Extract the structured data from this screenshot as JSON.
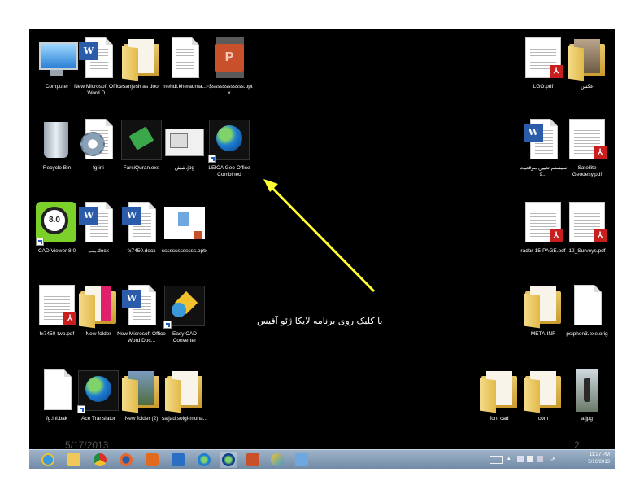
{
  "desktop": {
    "icons": [
      {
        "label": "Computer",
        "icon": "computer-icon"
      },
      {
        "label": "New Microsoft Office Word D...",
        "icon": "word-doc-icon"
      },
      {
        "label": "sanjesh as door",
        "icon": "folder-icon"
      },
      {
        "label": "mehdi.kheradma...",
        "icon": "text-file-icon"
      },
      {
        "label": "~$ssssssssssss.pptx",
        "icon": "pptx-icon"
      },
      {
        "label": "Recycle Bin",
        "icon": "recycle-bin-icon"
      },
      {
        "label": "fg.ini",
        "icon": "ini-settings-icon"
      },
      {
        "label": "FarsiQuran.exe",
        "icon": "book-exe-icon"
      },
      {
        "label": "شش.jpg",
        "icon": "image-file-icon"
      },
      {
        "label": "LEICA Geo Office Combined",
        "icon": "globe-app-icon"
      },
      {
        "label": "CAD Viewer 8.0",
        "icon": "cad-viewer-icon"
      },
      {
        "label": "بیب.docx",
        "icon": "word-doc-icon"
      },
      {
        "label": "fx7450.docx",
        "icon": "word-doc-icon"
      },
      {
        "label": "sssssssssssss.pptx",
        "icon": "pptx-thumbnail-icon"
      },
      {
        "label": "fx7450-two.pdf",
        "icon": "pdf-icon"
      },
      {
        "label": "New folder",
        "icon": "folder-icon"
      },
      {
        "label": "New Microsoft Office Word Doc...",
        "icon": "word-doc-icon"
      },
      {
        "label": "Easy CAD Converter",
        "icon": "cad-converter-icon"
      },
      {
        "label": "fg.ini.bak",
        "icon": "blank-file-icon"
      },
      {
        "label": "Ace Translator",
        "icon": "globe-app-icon"
      },
      {
        "label": "New folder (2)",
        "icon": "folder-icon"
      },
      {
        "label": "sajjad.solgi-moha...",
        "icon": "folder-icon"
      },
      {
        "label": "LGO.pdf",
        "icon": "pdf-icon"
      },
      {
        "label": "عکس",
        "icon": "folder-icon"
      },
      {
        "label": "سیستم تعیین موقعیت 9...",
        "icon": "word-doc-icon"
      },
      {
        "label": "Satellite Geodesy.pdf",
        "icon": "pdf-icon"
      },
      {
        "label": "radar-15-PAGE.pdf",
        "icon": "pdf-icon"
      },
      {
        "label": "12_Surveys.pdf",
        "icon": "pdf-icon"
      },
      {
        "label": "META-INF",
        "icon": "folder-icon"
      },
      {
        "label": "psiphon3.exe.orig",
        "icon": "blank-file-icon"
      },
      {
        "label": "font cad",
        "icon": "folder-icon"
      },
      {
        "label": "com",
        "icon": "folder-icon"
      },
      {
        "label": "a.jpg",
        "icon": "photo-icon"
      }
    ]
  },
  "annotation": {
    "caption": "با کلیک روی برنامه لایکا ژئو آفیس",
    "arrow_color": "#ffff33"
  },
  "slide": {
    "date": "5/17/2013",
    "number": "2"
  },
  "taskbar": {
    "apps": [
      "internet-explorer-icon",
      "file-explorer-icon",
      "chrome-icon",
      "firefox-icon",
      "media-player-icon",
      "remote-desktop-icon",
      "globe-icon",
      "leica-icon",
      "powerpoint-icon",
      "paint-icon",
      "network-icon"
    ],
    "clock_time": "11:27 PM",
    "clock_date": "5/16/2013"
  },
  "colors": {
    "desktop_bg": "#000000",
    "taskbar_bg": "#7f97b2"
  }
}
